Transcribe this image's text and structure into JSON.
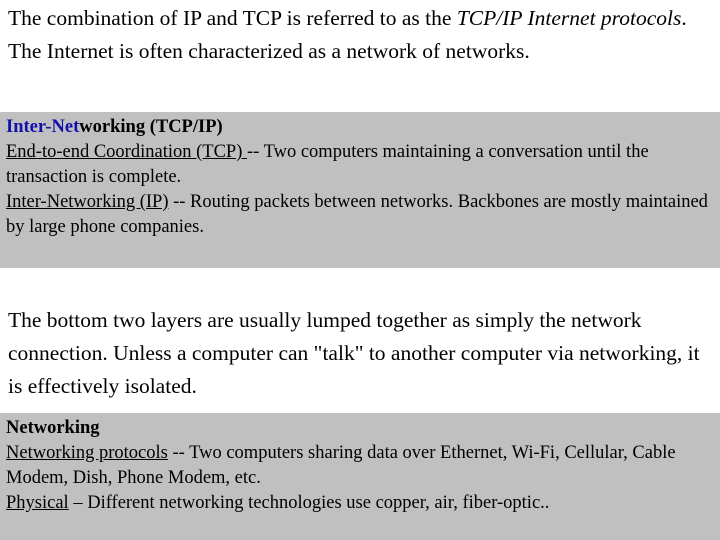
{
  "slide": {
    "background_color": "#ffffff",
    "highlight_color": "#c0c0c0",
    "accent_color": "#1111aa",
    "paragraph_top": {
      "segment_1": "The combination of IP and TCP is referred to as the ",
      "segment_2_italic": "TCP/IP Internet protocols",
      "segment_3": ".  The Internet is often characterized as a network of networks."
    },
    "block_internetworking": {
      "heading_accent": "Inter-Net",
      "heading_rest": "working (TCP/IP)",
      "line1_underlined": "End-to-end Coordination (TCP) ",
      "line1_rest": "-- Two computers maintaining a conversation until the transaction is complete.",
      "line2_underlined": "Inter-Networking (IP)",
      "line2_rest": " -- Routing packets between networks. Backbones are mostly maintained by large phone companies."
    },
    "paragraph_mid": "The bottom two layers are usually lumped together as simply the network connection.  Unless a computer can \"talk\" to another computer via networking, it is effectively isolated.",
    "block_networking": {
      "heading": "Networking",
      "line1_underlined": "Networking protocols",
      "line1_rest": " -- Two computers sharing data over Ethernet, Wi-Fi, Cellular, Cable Modem, Dish, Phone Modem, etc.",
      "line2_underlined": "Physical",
      "line2_rest": " – Different networking technologies use copper, air, fiber-optic.."
    }
  }
}
